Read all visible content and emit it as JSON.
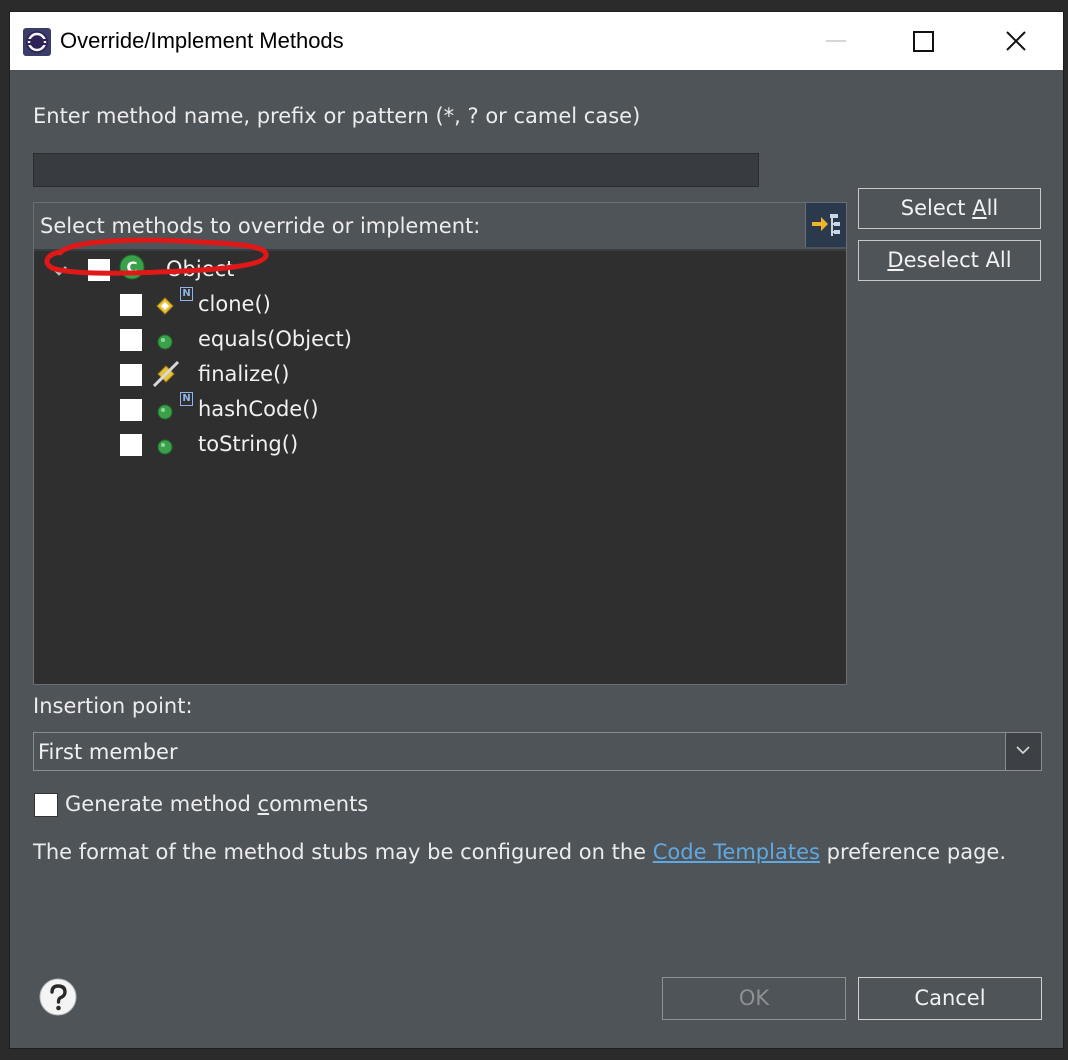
{
  "window": {
    "title": "Override/Implement Methods"
  },
  "filter": {
    "label": "Enter method name, prefix or pattern (*, ? or camel case)",
    "value": "",
    "placeholder": ""
  },
  "tree": {
    "header": "Select methods to override or implement:",
    "root": {
      "label": "Object",
      "checked": false,
      "expanded": true,
      "icon": "class-icon"
    },
    "methods": [
      {
        "label": "clone()",
        "checked": false,
        "icon": "protected-method-icon",
        "native": true
      },
      {
        "label": "equals(Object)",
        "checked": false,
        "icon": "public-method-icon",
        "native": false
      },
      {
        "label": "finalize()",
        "checked": false,
        "icon": "deprecated-protected-method-icon",
        "native": false
      },
      {
        "label": "hashCode()",
        "checked": false,
        "icon": "public-method-icon",
        "native": true
      },
      {
        "label": "toString()",
        "checked": false,
        "icon": "public-method-icon",
        "native": false
      }
    ],
    "native_marker": "N"
  },
  "buttons": {
    "select_all_pre": "Select ",
    "select_all_mnemonic": "A",
    "select_all_post": "ll",
    "deselect_all_mnemonic": "D",
    "deselect_all_post": "eselect All",
    "ok": "OK",
    "cancel": "Cancel"
  },
  "insertion": {
    "label": "Insertion point:",
    "selected": "First member"
  },
  "comments": {
    "pre": "Generate method ",
    "mnemonic": "c",
    "post": "omments",
    "checked": false
  },
  "footer": {
    "pre": "The format of the method stubs may be configured on the ",
    "link": "Code Templates",
    "post": " preference page."
  },
  "colors": {
    "dialog_bg": "#4f5459",
    "tree_bg": "#2f2f2f",
    "link": "#5fa8e0",
    "annotation": "#e01818",
    "method_icon_green": "#3aa04a",
    "protected_icon_yellow": "#e8c23a"
  }
}
